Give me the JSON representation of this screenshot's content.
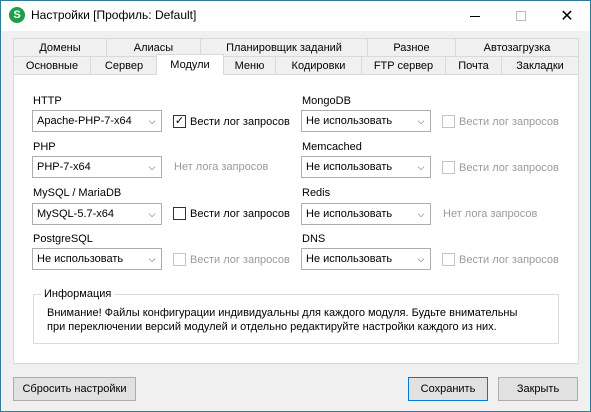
{
  "window": {
    "title": "Настройки [Профиль: Default]",
    "icon_letter": "S",
    "controls": [
      "minimize-icon",
      "maximize-icon",
      "close-icon"
    ]
  },
  "tabs": {
    "row_back": [
      "Домены",
      "Алиасы",
      "Планировщик заданий",
      "Разное",
      "Автозагрузка"
    ],
    "row_front": [
      "Основные",
      "Сервер",
      "Модули",
      "Меню",
      "Кодировки",
      "FTP сервер",
      "Почта",
      "Закладки"
    ],
    "active": "Модули"
  },
  "modules": {
    "http": {
      "label": "HTTP",
      "value": "Apache-PHP-7-x64",
      "log_label": "Вести лог запросов",
      "log_checked": true
    },
    "php": {
      "label": "PHP",
      "value": "PHP-7-x64",
      "note": "Нет лога запросов"
    },
    "mysql": {
      "label": "MySQL / MariaDB",
      "value": "MySQL-5.7-x64",
      "log_label": "Вести лог запросов",
      "log_checked": false
    },
    "postgresql": {
      "label": "PostgreSQL",
      "value": "Не использовать",
      "log_label": "Вести лог запросов",
      "log_checked": false
    },
    "mongodb": {
      "label": "MongoDB",
      "value": "Не использовать",
      "log_label": "Вести лог запросов",
      "log_checked": false
    },
    "memcached": {
      "label": "Memcached",
      "value": "Не использовать",
      "log_label": "Вести лог запросов",
      "log_checked": false
    },
    "redis": {
      "label": "Redis",
      "value": "Не использовать",
      "note": "Нет лога запросов"
    },
    "dns": {
      "label": "DNS",
      "value": "Не использовать",
      "log_label": "Вести лог запросов",
      "log_checked": false
    }
  },
  "info": {
    "title": "Информация",
    "line1": "Внимание! Файлы конфигурации индивидуальны для каждого модуля. Будьте внимательны",
    "line2": "при переключении версий модулей и отдельно редактируйте настройки каждого из них."
  },
  "buttons": {
    "reset": "Сбросить настройки",
    "save": "Сохранить",
    "close": "Закрыть"
  }
}
